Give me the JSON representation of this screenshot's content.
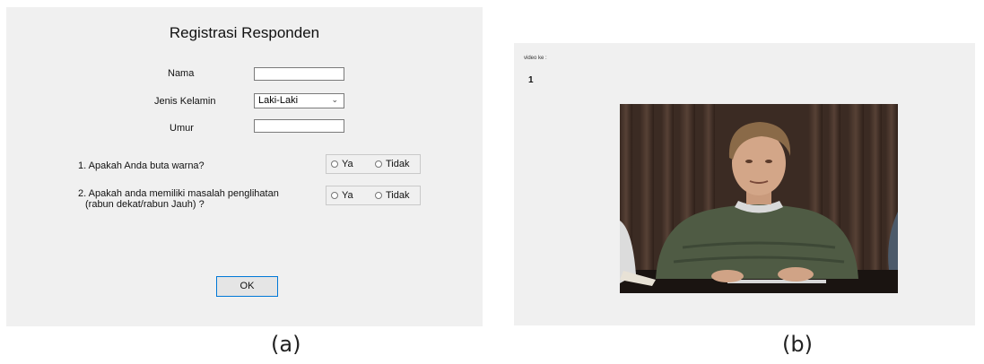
{
  "form": {
    "title": "Registrasi Responden",
    "nama_label": "Nama",
    "nama_value": "",
    "jenis_kelamin_label": "Jenis Kelamin",
    "jenis_kelamin_value": "Laki-Laki",
    "umur_label": "Umur",
    "umur_value": "",
    "question1": "1. Apakah Anda buta warna?",
    "question2_line1": "2. Apakah anda memiliki masalah penglihatan",
    "question2_line2": "(rabun dekat/rabun Jauh) ?",
    "option_yes": "Ya",
    "option_no": "Tidak",
    "ok_label": "OK"
  },
  "video": {
    "label": "video ke :",
    "number": "1"
  },
  "captions": {
    "a": "(a)",
    "b": "(b)"
  },
  "colors": {
    "panel_bg": "#f0f0f0",
    "button_border": "#0078d7"
  }
}
